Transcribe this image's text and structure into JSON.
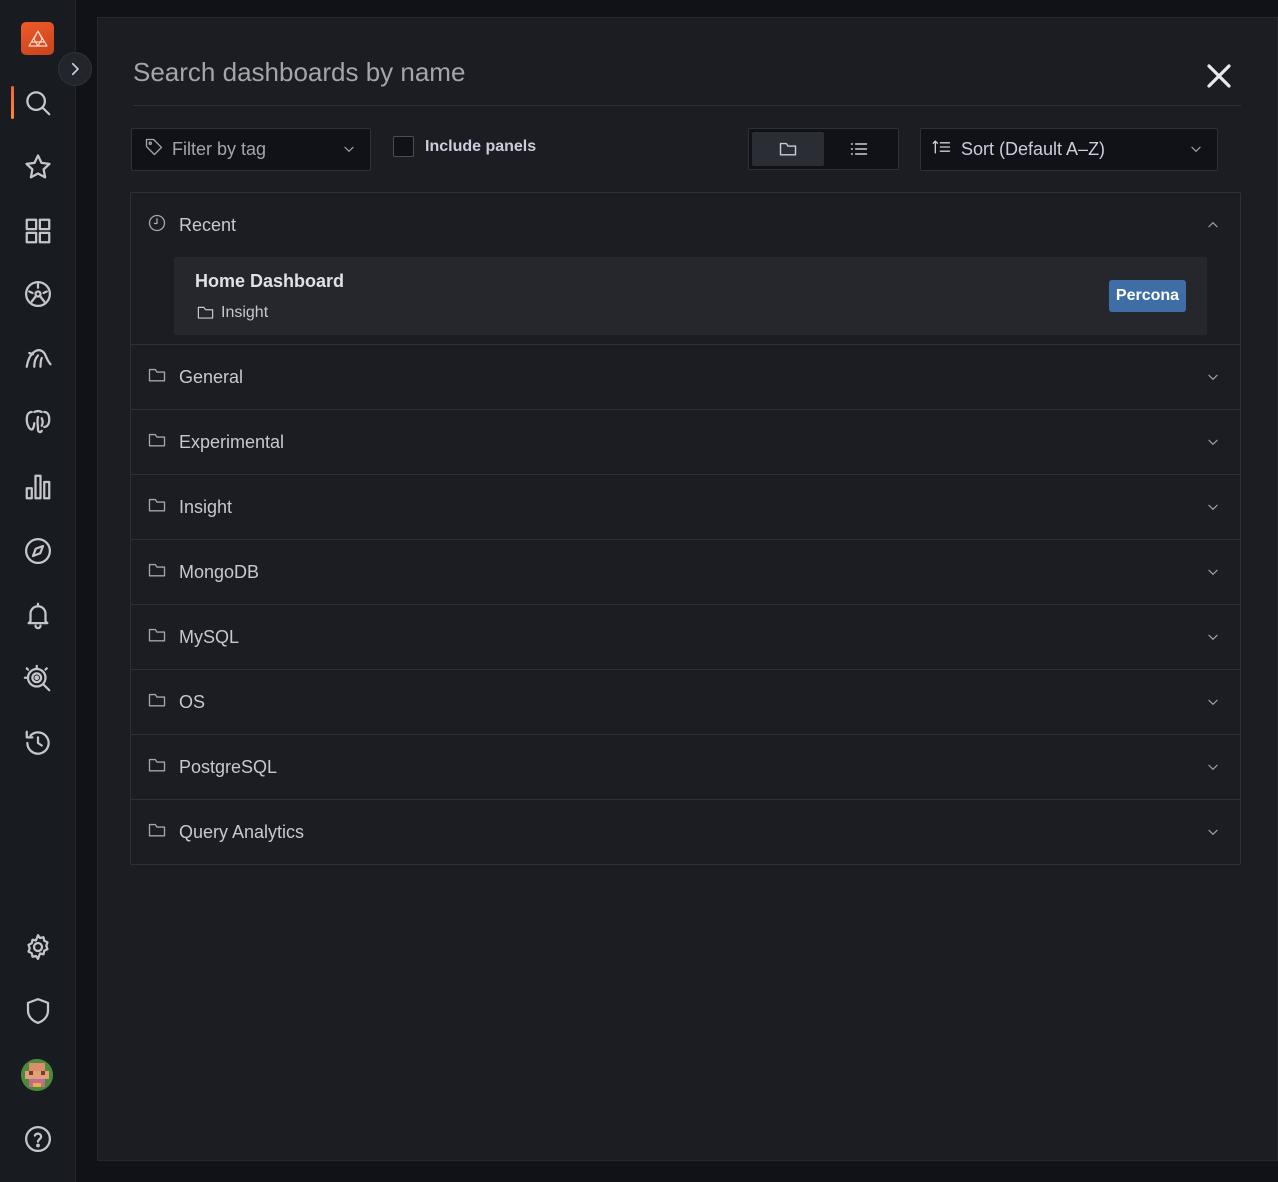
{
  "search": {
    "placeholder": "Search dashboards by name"
  },
  "filters": {
    "tag_label": "Filter by tag",
    "include_panels_label": "Include panels",
    "sort_label": "Sort (Default A–Z)"
  },
  "recent": {
    "title": "Recent",
    "dashboard": {
      "name": "Home Dashboard",
      "folder": "Insight",
      "tag": "Percona",
      "tag_color": "#3f6ea6"
    }
  },
  "folders": [
    "General",
    "Experimental",
    "Insight",
    "MongoDB",
    "MySQL",
    "OS",
    "PostgreSQL",
    "Query Analytics"
  ],
  "sidebar": {
    "icons": [
      "search-icon",
      "star-icon",
      "dashboards-icon",
      "pmm-dashboard-icon",
      "mysql-icon",
      "postgresql-icon",
      "bar-chart-icon",
      "compass-icon",
      "bell-icon",
      "query-analytics-icon",
      "history-icon",
      "gear-icon",
      "shield-icon",
      "avatar",
      "help-icon"
    ],
    "accent": "#f55f3e"
  }
}
